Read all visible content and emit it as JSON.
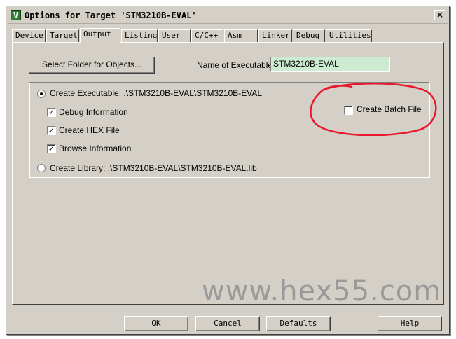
{
  "window": {
    "icon_letter": "V",
    "title": "Options for Target 'STM3210B-EVAL'",
    "close_glyph": "×"
  },
  "tabs": [
    {
      "label": "Device"
    },
    {
      "label": "Target"
    },
    {
      "label": "Output",
      "active": true
    },
    {
      "label": "Listing"
    },
    {
      "label": "User"
    },
    {
      "label": "C/C++"
    },
    {
      "label": "Asm"
    },
    {
      "label": "Linker"
    },
    {
      "label": "Debug"
    },
    {
      "label": "Utilities"
    }
  ],
  "output": {
    "select_folder_label": "Select Folder for Objects...",
    "name_exec_label": "Name of Executable:",
    "name_exec_value": "STM3210B-EVAL",
    "create_exec_label": "Create Executable:  .\\STM3210B-EVAL\\STM3210B-EVAL",
    "create_exec_selected": true,
    "debug_info_label": "Debug Information",
    "debug_info_checked": true,
    "hex_label": "Create HEX File",
    "hex_checked": true,
    "browse_label": "Browse Information",
    "browse_checked": true,
    "create_lib_label": "Create Library:  .\\STM3210B-EVAL\\STM3210B-EVAL.lib",
    "create_lib_selected": false,
    "batch_label": "Create Batch File",
    "batch_checked": false,
    "check_glyph": "✓"
  },
  "buttons": {
    "ok": "OK",
    "cancel": "Cancel",
    "defaults": "Defaults",
    "help": "Help"
  },
  "watermark": "www.hex55.com",
  "colors": {
    "dialog_bg": "#d4d0c8",
    "exec_field_bg": "#ccebd1",
    "annotation_red": "#e8192c",
    "app_icon_green": "#2e7d32"
  }
}
